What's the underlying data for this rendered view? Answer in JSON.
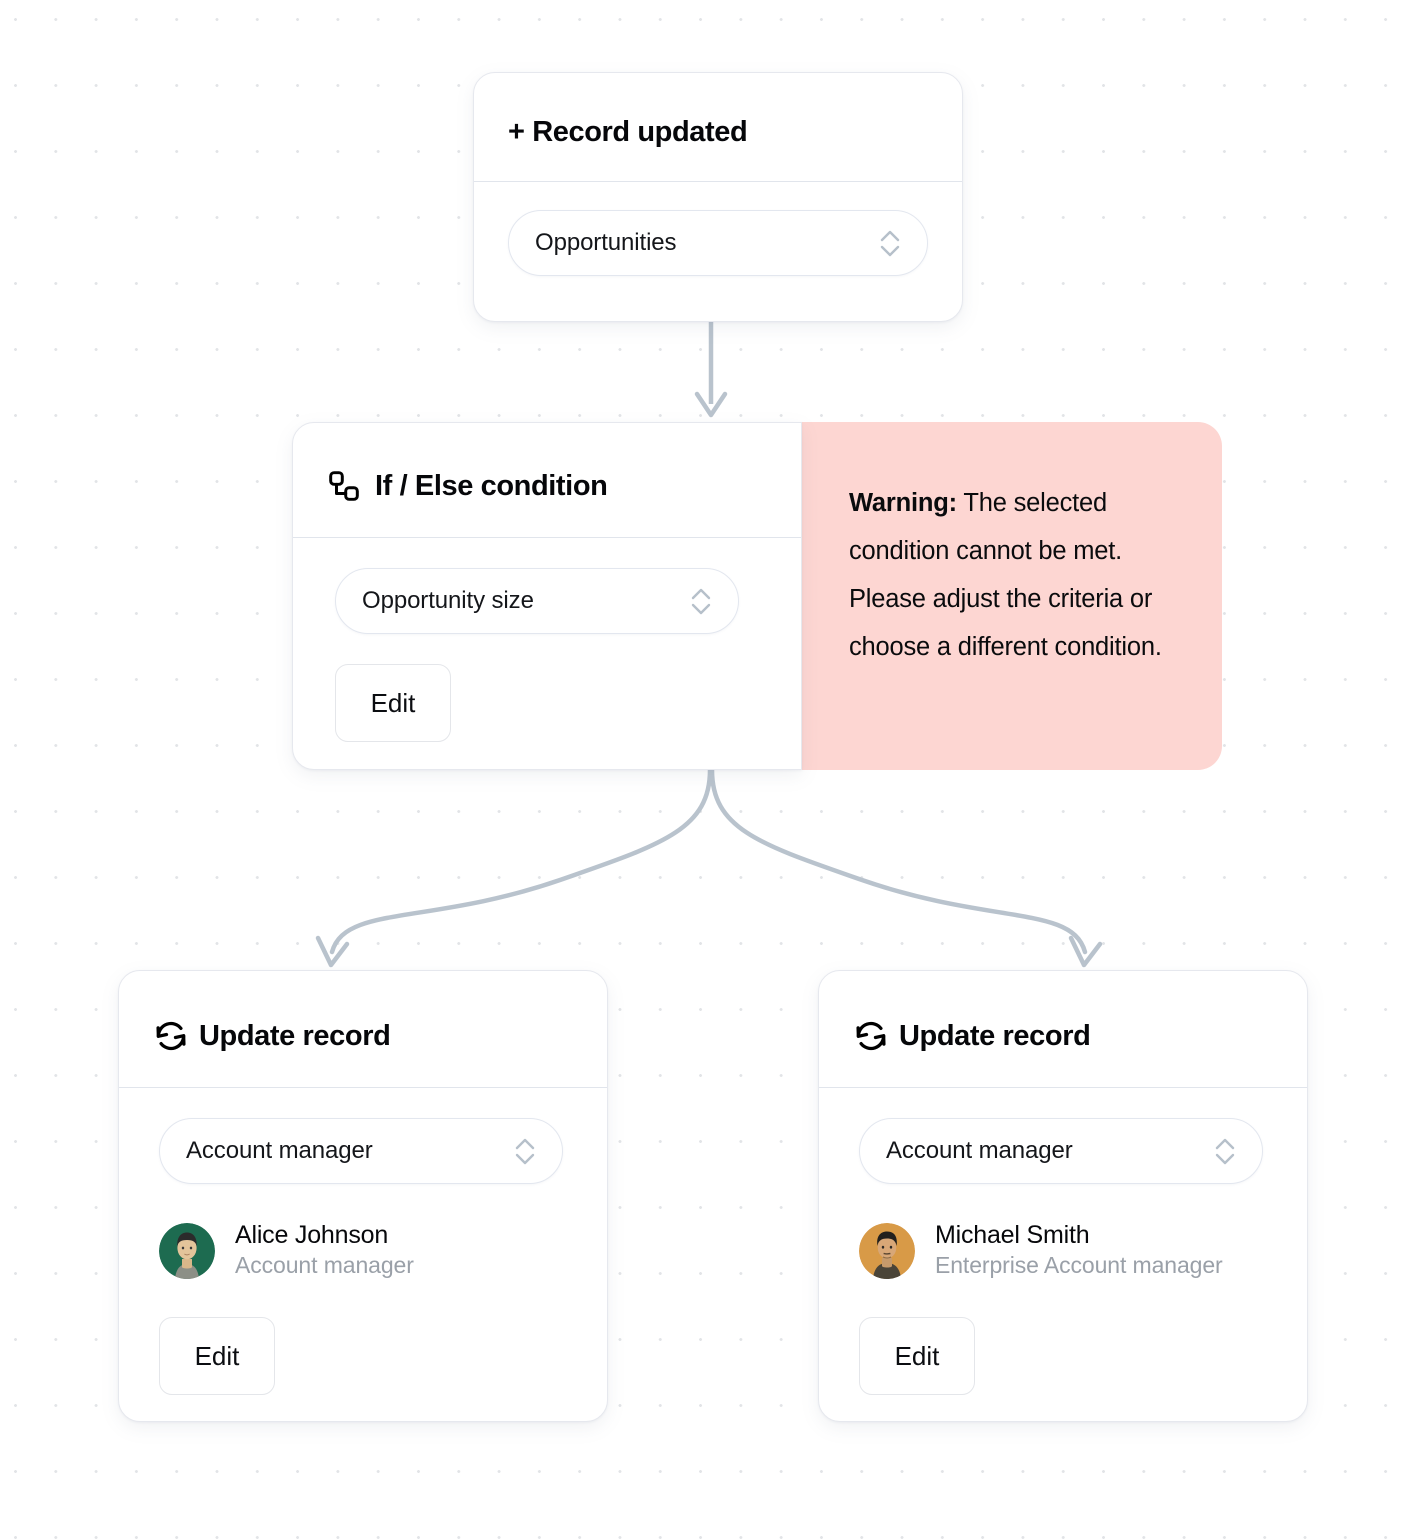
{
  "canvas": {
    "background": "#ffffff",
    "dot_color": "#e2e4e7",
    "connector_color": "#b9c3cd"
  },
  "nodes": {
    "trigger": {
      "icon": "plus-icon",
      "title": "+ Record updated",
      "title_prefix": "+",
      "title_text": "Record updated",
      "select": {
        "value": "Opportunities",
        "icon": "chevron-updown-icon"
      }
    },
    "condition": {
      "icon": "branch-condition-icon",
      "title": "If / Else condition",
      "select": {
        "value": "Opportunity size",
        "icon": "chevron-updown-icon"
      },
      "edit_label": "Edit"
    },
    "warning": {
      "label": "Warning:",
      "message": "The selected condition cannot be met. Please adjust the criteria or choose a different condition.",
      "background": "#fdd6d2",
      "text_color": "#0a0b0d"
    },
    "update_left": {
      "icon": "refresh-icon",
      "title": "Update record",
      "select": {
        "value": "Account manager",
        "icon": "chevron-updown-icon"
      },
      "person": {
        "avatar": "avatar-alice-johnson",
        "avatar_background": "#1d6b50",
        "name": "Alice Johnson",
        "role": "Account manager"
      },
      "edit_label": "Edit"
    },
    "update_right": {
      "icon": "refresh-icon",
      "title": "Update record",
      "select": {
        "value": "Account manager",
        "icon": "chevron-updown-icon"
      },
      "person": {
        "avatar": "avatar-michael-smith",
        "avatar_background": "#d89a47",
        "name": "Michael Smith",
        "role": "Enterprise Account manager"
      },
      "edit_label": "Edit"
    }
  }
}
